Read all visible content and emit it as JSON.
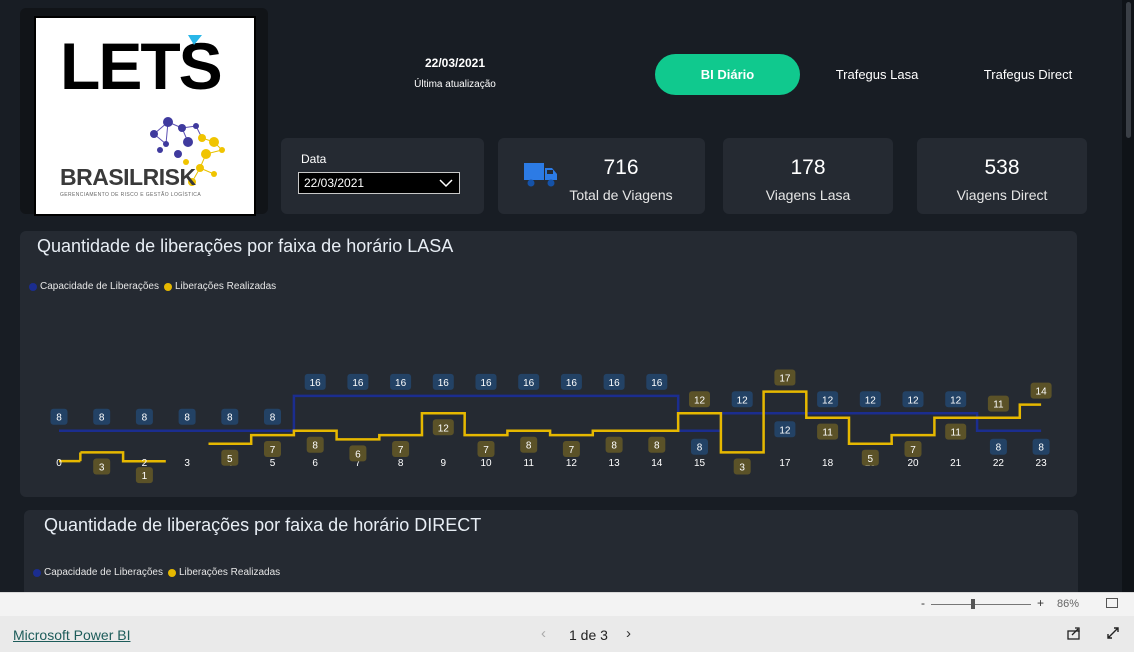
{
  "logo": {
    "brand_name": "LETS",
    "partner_name": "BRASILRISK",
    "partner_tagline": "GERENCIAMENTO DE RISCO E GESTÃO LOGÍSTICA"
  },
  "update": {
    "date": "22/03/2021",
    "label": "Última atualização"
  },
  "nav": {
    "active": "BI Diário",
    "lasa": "Trafegus Lasa",
    "direct": "Trafegus Direct"
  },
  "slicer": {
    "label": "Data",
    "value": "22/03/2021"
  },
  "kpis": [
    {
      "value": "716",
      "label": "Total de Viagens",
      "icon": "truck-icon"
    },
    {
      "value": "178",
      "label": "Viagens Lasa"
    },
    {
      "value": "538",
      "label": "Viagens Direct"
    }
  ],
  "colors": {
    "capacity": "#1b2d8f",
    "realized": "#e6b800",
    "accent": "#10c98e",
    "cap_label_bg": "#234265",
    "real_label_bg": "#5b5228"
  },
  "chart_data": [
    {
      "type": "line",
      "title": "Quantidade de liberações por faixa de horário LASA",
      "x": [
        "0",
        "1",
        "2",
        "3",
        "4",
        "5",
        "6",
        "7",
        "8",
        "9",
        "10",
        "11",
        "12",
        "13",
        "14",
        "15",
        "16",
        "17",
        "18",
        "19",
        "20",
        "21",
        "22",
        "23"
      ],
      "series": [
        {
          "name": "Capacidade de Liberações",
          "values": [
            8,
            8,
            8,
            8,
            8,
            8,
            16,
            16,
            16,
            16,
            16,
            16,
            16,
            16,
            16,
            8,
            12,
            12,
            12,
            12,
            12,
            12,
            8,
            8
          ]
        },
        {
          "name": "Liberações Realizadas",
          "values": [
            null,
            3,
            1,
            null,
            5,
            7,
            8,
            6,
            7,
            12,
            7,
            8,
            7,
            8,
            8,
            12,
            3,
            17,
            11,
            5,
            7,
            11,
            11,
            14
          ]
        }
      ],
      "step": true,
      "legend_position": "top-left",
      "grid": false
    },
    {
      "type": "line",
      "title": "Quantidade de liberações por faixa de horário DIRECT",
      "series": [
        {
          "name": "Capacidade de Liberações"
        },
        {
          "name": "Liberações Realizadas"
        }
      ],
      "legend_position": "top-left"
    }
  ],
  "zoom": {
    "minus": "-",
    "plus": "+",
    "percent": "86%"
  },
  "footer": {
    "powerbi": "Microsoft Power BI",
    "page": "1 de 3",
    "prev": "‹",
    "next": "›"
  }
}
